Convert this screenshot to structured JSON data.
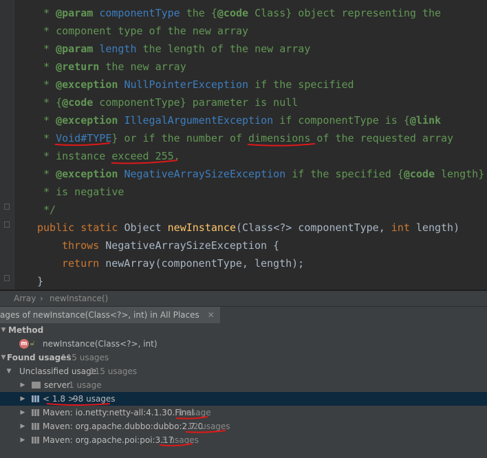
{
  "code": {
    "l1": {
      "star": " * ",
      "tag": "@param",
      "ref": "componentType",
      "rest": " the {",
      "code": "@code",
      "rest2": " Class} object representing the"
    },
    "l2": {
      "text": " * component type of the new array"
    },
    "l3": {
      "star": " * ",
      "tag": "@param",
      "ref": "length",
      "rest": " the length of the new array"
    },
    "l4": {
      "star": " * ",
      "tag": "@return",
      "rest": " the new array"
    },
    "l5": {
      "star": " * ",
      "tag": "@exception",
      "ref": "NullPointerException",
      "rest": " if the specified"
    },
    "l6": {
      "star": " * {",
      "code": "@code",
      "rest": " componentType} parameter is null"
    },
    "l7": {
      "star": " * ",
      "tag": "@exception",
      "ref": "IllegalArgumentException",
      "rest": " if componentType is {",
      "link": "@link"
    },
    "l8": {
      "star": " * ",
      "ref": "Void#TYPE",
      "rest": "} or if the number of dimensions of the requested array"
    },
    "l9": {
      "text": " * instance exceed 255."
    },
    "l10": {
      "star": " * ",
      "tag": "@exception",
      "ref": "NegativeArraySizeException",
      "rest": " if the specified {",
      "code": "@code",
      "rest2": " length}"
    },
    "l11": {
      "text": " * is negative"
    },
    "l12": {
      "text": " */"
    },
    "l13": {
      "kw1": "public static ",
      "cls": "Object ",
      "fn": "newInstance",
      "p1": "(",
      "cls2": "Class",
      "p2": "<?> componentType, ",
      "kw2": "int",
      "p3": " length)"
    },
    "l14": {
      "kw": "throws ",
      "cls": "NegativeArraySizeException",
      "p": " {"
    },
    "l15": {
      "kw": "return ",
      "p": "newArray(componentType, length);"
    },
    "l16": {
      "p": "}"
    }
  },
  "breadcrumb": {
    "item1": "Array",
    "sep": "›",
    "item2": "newInstance()"
  },
  "find_tab": {
    "label": "ages of newInstance(Class<?>, int) in All Places",
    "close": "✕"
  },
  "tree": {
    "method_header": "Method",
    "method_name": "newInstance(Class<?>, int)",
    "found_label": "Found usages",
    "found_count": "115 usages",
    "unclassified_label": "Unclassified usage",
    "unclassified_count": "115 usages",
    "items": [
      {
        "label": "server",
        "count": "1 usage"
      },
      {
        "label": "< 1.8 >",
        "count": "98 usages"
      },
      {
        "label": "Maven: io.netty:netty-all:4.1.30.Final",
        "count": "1 usage"
      },
      {
        "label": "Maven: org.apache.dubbo:dubbo:2.7.0",
        "count": "12 usages"
      },
      {
        "label": "Maven: org.apache.poi:poi:3.17",
        "count": "3 usages"
      }
    ]
  },
  "colors": {
    "annotation_ink": "#e01919",
    "selection": "#0d293e",
    "comment": "#629755",
    "keyword": "#cc7832"
  }
}
